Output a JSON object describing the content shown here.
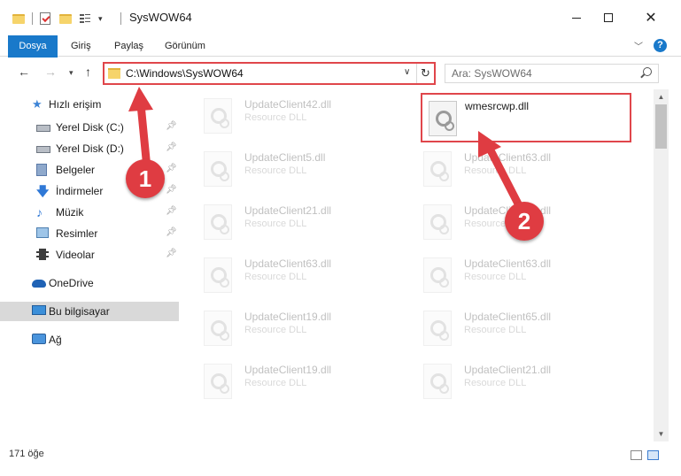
{
  "window": {
    "title": "SysWOW64"
  },
  "ribbon": {
    "tabs": [
      "Dosya",
      "Giriş",
      "Paylaş",
      "Görünüm"
    ],
    "help_label": "?"
  },
  "navigation": {
    "address_path": "C:\\Windows\\SysWOW64",
    "search_placeholder": "Ara: SysWOW64"
  },
  "sidebar": {
    "quick_access_label": "Hızlı erişim",
    "items": [
      {
        "label": "Yerel Disk (C:)",
        "icon": "disk-icon",
        "pinned": true
      },
      {
        "label": "Yerel Disk (D:)",
        "icon": "disk-icon",
        "pinned": true
      },
      {
        "label": "Belgeler",
        "icon": "documents-icon",
        "pinned": true
      },
      {
        "label": "İndirmeler",
        "icon": "download-icon",
        "pinned": true
      },
      {
        "label": "Müzik",
        "icon": "music-icon",
        "pinned": true
      },
      {
        "label": "Resimler",
        "icon": "pictures-icon",
        "pinned": true
      },
      {
        "label": "Videolar",
        "icon": "videos-icon",
        "pinned": true
      }
    ],
    "onedrive_label": "OneDrive",
    "this_pc_label": "Bu bilgisayar",
    "network_label": "Ağ"
  },
  "files": {
    "left_column": [
      {
        "name": "UpdateClient42.dll",
        "type": "Resource DLL"
      },
      {
        "name": "UpdateClient5.dll",
        "type": "Resource DLL"
      },
      {
        "name": "UpdateClient21.dll",
        "type": "Resource DLL"
      },
      {
        "name": "UpdateClient63.dll",
        "type": "Resource DLL"
      },
      {
        "name": "UpdateClient19.dll",
        "type": "Resource DLL"
      },
      {
        "name": "UpdateClient19.dll",
        "type": "Resource DLL"
      }
    ],
    "right_column": [
      {
        "name": "wmesrcwp.dll",
        "type": ""
      },
      {
        "name": "UpdateClient63.dll",
        "type": "Resource DLL"
      },
      {
        "name": "UpdateClient63.dll",
        "type": "Resource DLL"
      },
      {
        "name": "UpdateClient63.dll",
        "type": "Resource DLL"
      },
      {
        "name": "UpdateClient65.dll",
        "type": "Resource DLL"
      },
      {
        "name": "UpdateClient21.dll",
        "type": "Resource DLL"
      }
    ]
  },
  "status": {
    "item_count": "171 öğe"
  },
  "annotations": {
    "step1": "1",
    "step2": "2"
  },
  "colors": {
    "accent": "#1979ca",
    "highlight_red": "#e0464b",
    "badge_red": "#df3c42",
    "selected_bg": "#d9d9d9"
  }
}
